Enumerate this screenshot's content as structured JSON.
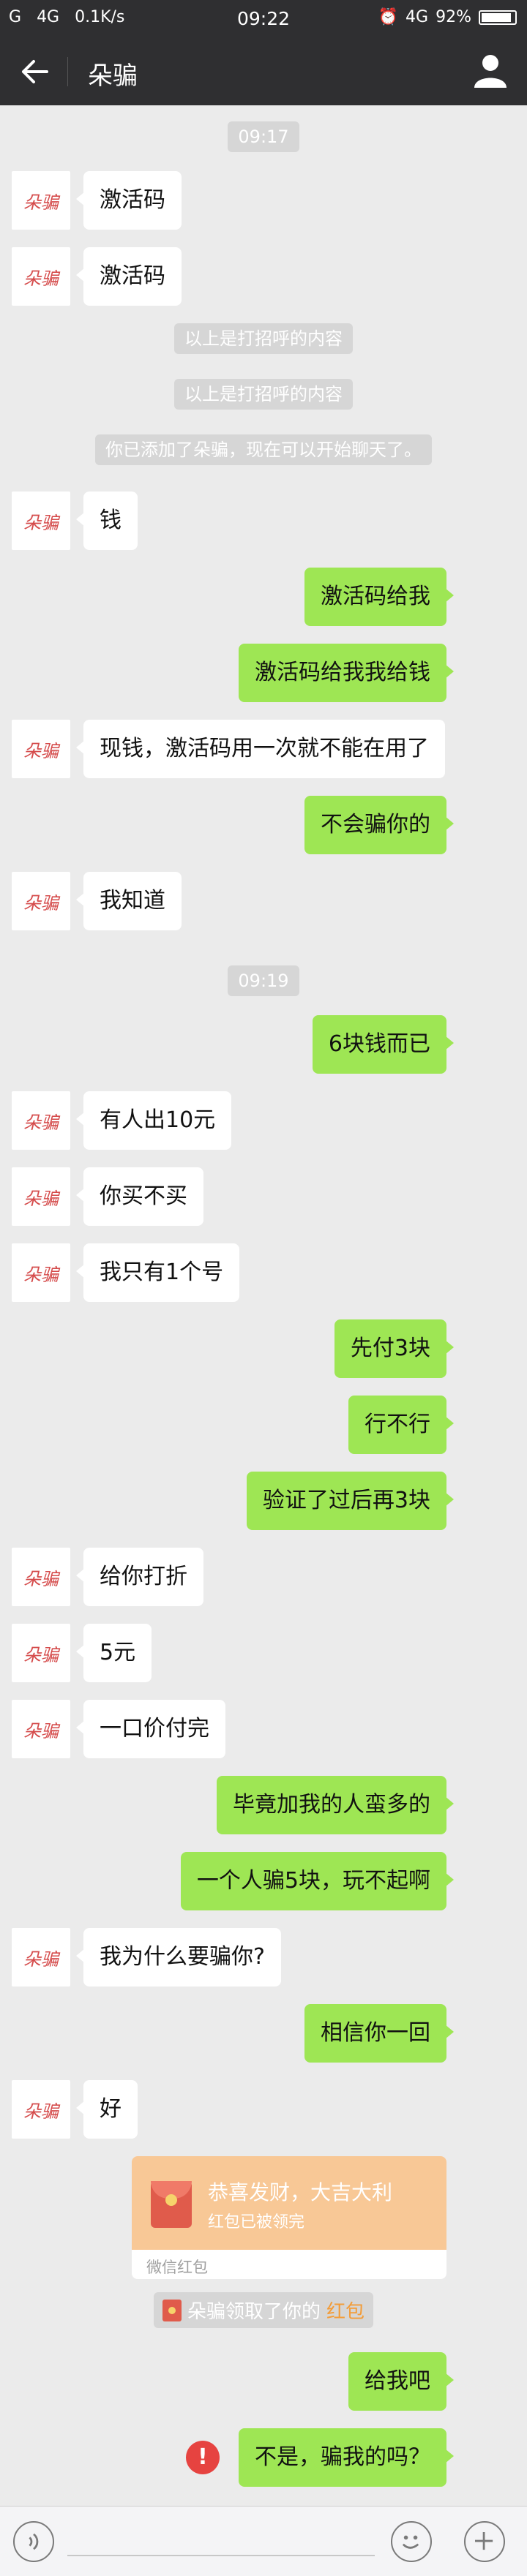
{
  "status_bar": {
    "carrier1": "G",
    "carrier2": "4G",
    "speed": "0.1K/s",
    "time": "09:22",
    "net": "4G",
    "battery": "92%"
  },
  "header": {
    "title": "朵骗"
  },
  "avatar_label": "朵骗",
  "messages": {
    "t1": "09:17",
    "m1": "激活码",
    "m2": "激活码",
    "s1": "以上是打招呼的内容",
    "s2": "以上是打招呼的内容",
    "s3": "你已添加了朵骗，现在可以开始聊天了。",
    "m3": "钱",
    "m4": "激活码给我",
    "m5": "激活码给我我给钱",
    "m6": "现钱，激活码用一次就不能在用了",
    "m7": "不会骗你的",
    "m8": "我知道",
    "t2": "09:19",
    "m9": "6块钱而已",
    "m10": "有人出10元",
    "m11": "你买不买",
    "m12": "我只有1个号",
    "m13": "先付3块",
    "m14": "行不行",
    "m15": "验证了过后再3块",
    "m16": "给你打折",
    "m17": "5元",
    "m18": "一口价付完",
    "m19": "毕竟加我的人蛮多的",
    "m20": "一个人骗5块，玩不起啊",
    "m21": "我为什么要骗你?",
    "m22": "相信你一回",
    "m23": "好",
    "m24": "给我吧",
    "m25": "不是，骗我的吗？"
  },
  "red_packet": {
    "greeting": "恭喜发财，大吉大利",
    "status": "红包已被领完",
    "footer": "微信红包",
    "notice_prefix": "朵骗领取了你的",
    "notice_link": "红包"
  },
  "send_error": "!"
}
